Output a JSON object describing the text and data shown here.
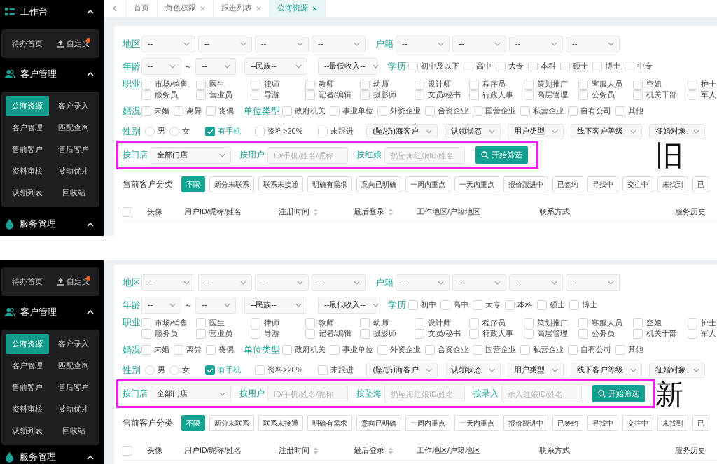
{
  "panels": [
    {
      "annotation": "旧",
      "sidebar": {
        "groups": [
          {
            "title": "工作台",
            "expanded": true,
            "items": [
              {
                "label": "待办首页",
                "kind": "plain",
                "selected": false,
                "dot": false
              },
              {
                "label": "自定义",
                "kind": "icon",
                "selected": false,
                "dot": true
              }
            ]
          },
          {
            "title": "客户管理",
            "expanded": true,
            "items": [
              {
                "label": "公海资源",
                "selected": true
              },
              {
                "label": "客户录入",
                "selected": false
              },
              {
                "label": "客户管理",
                "selected": false
              },
              {
                "label": "匹配查询",
                "selected": false
              },
              {
                "label": "售前客户",
                "selected": false
              },
              {
                "label": "售后客户",
                "selected": false
              },
              {
                "label": "资料审核",
                "selected": false
              },
              {
                "label": "被动优才",
                "selected": false
              },
              {
                "label": "认领列表",
                "selected": false
              },
              {
                "label": "回收站",
                "selected": false
              }
            ]
          },
          {
            "title": "服务管理",
            "expanded": true
          }
        ]
      },
      "tabs": [
        {
          "label": "首页",
          "selected": false,
          "closable": false
        },
        {
          "label": "角色权限",
          "selected": false,
          "closable": true
        },
        {
          "label": "跟进列表",
          "selected": false,
          "closable": true
        },
        {
          "label": "公海资源",
          "selected": true,
          "closable": true
        }
      ],
      "filters": {
        "region": {
          "label": "地区",
          "selects": [
            "--",
            "--",
            "--",
            "--"
          ]
        },
        "hukou": {
          "label": "户籍",
          "selects": [
            "--",
            "--",
            "--",
            "--"
          ]
        },
        "age": {
          "label": "年龄",
          "from": "--",
          "separator": "～",
          "to": "--"
        },
        "ethnicity": "--民族--",
        "income": "--最低收入--",
        "education": {
          "label": "学历",
          "options": [
            {
              "label": "初中及以下",
              "checked": false
            },
            {
              "label": "高中",
              "checked": false
            },
            {
              "label": "大专",
              "checked": false
            },
            {
              "label": "本科",
              "checked": false
            },
            {
              "label": "硕士",
              "checked": false
            },
            {
              "label": "博士",
              "checked": false
            },
            {
              "label": "中专",
              "checked": false
            }
          ]
        },
        "occupation": {
          "label": "职业",
          "options": [
            {
              "label": "市场/销售",
              "checked": false
            },
            {
              "label": "医生",
              "checked": false
            },
            {
              "label": "律师",
              "checked": false
            },
            {
              "label": "教师",
              "checked": false
            },
            {
              "label": "幼师",
              "checked": false
            },
            {
              "label": "设计师",
              "checked": false
            },
            {
              "label": "程序员",
              "checked": false
            },
            {
              "label": "策划推广",
              "checked": false
            },
            {
              "label": "客服人员",
              "checked": false
            },
            {
              "label": "空姐",
              "checked": false
            },
            {
              "label": "护士",
              "checked": false
            },
            {
              "label": "服务员",
              "checked": false
            },
            {
              "label": "营业员",
              "checked": false
            },
            {
              "label": "导游",
              "checked": false
            },
            {
              "label": "记者/编辑",
              "checked": false
            },
            {
              "label": "摄影师",
              "checked": false
            },
            {
              "label": "文员/秘书",
              "checked": false
            },
            {
              "label": "行政人事",
              "checked": false
            },
            {
              "label": "高层管理",
              "checked": false
            },
            {
              "label": "公务员",
              "checked": false
            },
            {
              "label": "机关干部",
              "checked": false
            },
            {
              "label": "军人",
              "checked": false
            }
          ]
        },
        "marriage": {
          "label": "婚况",
          "options": [
            {
              "label": "未婚",
              "checked": false
            },
            {
              "label": "离异",
              "checked": false
            },
            {
              "label": "丧偶",
              "checked": false
            }
          ]
        },
        "unit_type": {
          "label": "单位类型",
          "options": [
            {
              "label": "政府机关",
              "checked": false
            },
            {
              "label": "事业单位",
              "checked": false
            },
            {
              "label": "外资企业",
              "checked": false
            },
            {
              "label": "合资企业",
              "checked": false
            },
            {
              "label": "国营企业",
              "checked": false
            },
            {
              "label": "私营企业",
              "checked": false
            },
            {
              "label": "自有公司",
              "checked": false
            },
            {
              "label": "其他",
              "checked": false
            }
          ]
        },
        "gender": {
          "label": "性别",
          "options": [
            {
              "label": "男",
              "selected": false
            },
            {
              "label": "女",
              "selected": false
            }
          ]
        },
        "flags": [
          {
            "label": "有手机",
            "checked": true
          },
          {
            "label": "资料>20%",
            "checked": false
          },
          {
            "label": "未跟进",
            "checked": false
          }
        ],
        "dropdowns": [
          "(坠/扔)海客户",
          "认领状态",
          "用户类型",
          "线下客户等级",
          "征婚对象"
        ]
      },
      "search": {
        "highlighted": true,
        "fields": [
          {
            "label": "按门店",
            "kind": "select",
            "value": "全部门店"
          },
          {
            "label": "按用户",
            "kind": "input",
            "placeholder": "ID/手机/姓名/昵称"
          },
          {
            "label": "按红娘",
            "kind": "input",
            "placeholder": "扔坠海红娘ID/姓名"
          }
        ],
        "button": "开始筛选"
      },
      "category": {
        "label": "售前客户分类",
        "options": [
          {
            "label": "不限",
            "selected": true
          },
          {
            "label": "新分未联系",
            "selected": false
          },
          {
            "label": "联系未接通",
            "selected": false
          },
          {
            "label": "明确有需求",
            "selected": false
          },
          {
            "label": "意向已明确",
            "selected": false
          },
          {
            "label": "一周内重点",
            "selected": false
          },
          {
            "label": "一天内重点",
            "selected": false
          },
          {
            "label": "报价跟进中",
            "selected": false
          },
          {
            "label": "已签约",
            "selected": false
          },
          {
            "label": "寻找中",
            "selected": false
          },
          {
            "label": "交往中",
            "selected": false
          },
          {
            "label": "未找到",
            "selected": false
          },
          {
            "label": "已",
            "selected": false
          }
        ]
      },
      "table": {
        "all_checked": false,
        "columns": [
          {
            "label": "头像",
            "sortable": false
          },
          {
            "label": "用户ID/昵称/姓名",
            "sortable": false
          },
          {
            "label": "注册时间",
            "sortable": true
          },
          {
            "label": "最后登录",
            "sortable": true
          },
          {
            "label": "工作地区/户籍地区",
            "sortable": false
          },
          {
            "label": "联系方式",
            "sortable": false
          },
          {
            "label": "服务历史",
            "sortable": false
          }
        ]
      }
    },
    {
      "annotation": "新",
      "sidebar": {
        "groups": [
          {
            "items": [
              {
                "label": "待办首页",
                "kind": "plain",
                "selected": false,
                "dot": false
              },
              {
                "label": "自定义",
                "kind": "icon",
                "selected": false,
                "dot": true
              }
            ]
          },
          {
            "title": "客户管理",
            "expanded": true,
            "items": [
              {
                "label": "公海资源",
                "selected": true
              },
              {
                "label": "客户录入",
                "selected": false
              },
              {
                "label": "客户管理",
                "selected": false
              },
              {
                "label": "匹配查询",
                "selected": false
              },
              {
                "label": "售前客户",
                "selected": false
              },
              {
                "label": "售后客户",
                "selected": false
              },
              {
                "label": "资料审核",
                "selected": false
              },
              {
                "label": "被动优才",
                "selected": false
              },
              {
                "label": "认领列表",
                "selected": false
              },
              {
                "label": "回收站",
                "selected": false
              }
            ]
          },
          {
            "title": "服务管理",
            "expanded": true
          }
        ]
      },
      "filters": {
        "region": {
          "label": "地区",
          "selects": [
            "--",
            "--",
            "--",
            "--"
          ]
        },
        "hukou": {
          "label": "户籍",
          "selects": [
            "--",
            "--",
            "--",
            "--"
          ]
        },
        "age": {
          "label": "年龄",
          "from": "--",
          "separator": "～",
          "to": "--"
        },
        "ethnicity": "--民族--",
        "income": "--最低收入--",
        "education": {
          "label": "学历",
          "options": [
            {
              "label": "初中",
              "checked": false
            },
            {
              "label": "高中",
              "checked": false
            },
            {
              "label": "大专",
              "checked": false
            },
            {
              "label": "本科",
              "checked": false
            },
            {
              "label": "硕士",
              "checked": false
            },
            {
              "label": "博士",
              "checked": false
            }
          ]
        },
        "occupation": {
          "label": "职业",
          "options": [
            {
              "label": "市场/销售",
              "checked": false
            },
            {
              "label": "医生",
              "checked": false
            },
            {
              "label": "律师",
              "checked": false
            },
            {
              "label": "教师",
              "checked": false
            },
            {
              "label": "幼师",
              "checked": false
            },
            {
              "label": "设计师",
              "checked": false
            },
            {
              "label": "程序员",
              "checked": false
            },
            {
              "label": "策划推广",
              "checked": false
            },
            {
              "label": "客服人员",
              "checked": false
            },
            {
              "label": "空姐",
              "checked": false
            },
            {
              "label": "护士",
              "checked": false
            },
            {
              "label": "服务员",
              "checked": false
            },
            {
              "label": "营业员",
              "checked": false
            },
            {
              "label": "导游",
              "checked": false
            },
            {
              "label": "记者/编辑",
              "checked": false
            },
            {
              "label": "摄影师",
              "checked": false
            },
            {
              "label": "文员/秘书",
              "checked": false
            },
            {
              "label": "行政人事",
              "checked": false
            },
            {
              "label": "高层管理",
              "checked": false
            },
            {
              "label": "公务员",
              "checked": false
            },
            {
              "label": "机关干部",
              "checked": false
            },
            {
              "label": "军人",
              "checked": false
            }
          ]
        },
        "marriage": {
          "label": "婚况",
          "options": [
            {
              "label": "未婚",
              "checked": false
            },
            {
              "label": "离异",
              "checked": false
            },
            {
              "label": "丧偶",
              "checked": false
            }
          ]
        },
        "unit_type": {
          "label": "单位类型",
          "options": [
            {
              "label": "政府机关",
              "checked": false
            },
            {
              "label": "事业单位",
              "checked": false
            },
            {
              "label": "外资企业",
              "checked": false
            },
            {
              "label": "合资企业",
              "checked": false
            },
            {
              "label": "国营企业",
              "checked": false
            },
            {
              "label": "私营企业",
              "checked": false
            },
            {
              "label": "自有公司",
              "checked": false
            },
            {
              "label": "其他",
              "checked": false
            }
          ]
        },
        "gender": {
          "label": "性别",
          "options": [
            {
              "label": "男",
              "selected": false
            },
            {
              "label": "女",
              "selected": false
            }
          ]
        },
        "flags": [
          {
            "label": "有手机",
            "checked": true
          },
          {
            "label": "资料>20%",
            "checked": false
          },
          {
            "label": "未跟进",
            "checked": false
          }
        ],
        "dropdowns": [
          "(坠/扔)海客户",
          "认领状态",
          "用户类型",
          "线下客户等级",
          "征婚对象"
        ]
      },
      "search": {
        "highlighted": true,
        "fields": [
          {
            "label": "按门店",
            "kind": "select",
            "value": "全部门店"
          },
          {
            "label": "按用户",
            "kind": "input",
            "placeholder": "ID/手机/姓名/昵称"
          },
          {
            "label": "按坠海",
            "kind": "input",
            "placeholder": "扔坠海红娘ID/姓名"
          },
          {
            "label": "按录入",
            "kind": "input",
            "placeholder": "录入红娘ID/姓名"
          }
        ],
        "button": "开始筛选"
      },
      "category": {
        "label": "售前客户分类",
        "options": [
          {
            "label": "不限",
            "selected": true
          },
          {
            "label": "新分未联系",
            "selected": false
          },
          {
            "label": "联系未接通",
            "selected": false
          },
          {
            "label": "明确有需求",
            "selected": false
          },
          {
            "label": "意向已明确",
            "selected": false
          },
          {
            "label": "一周内重点",
            "selected": false
          },
          {
            "label": "一天内重点",
            "selected": false
          },
          {
            "label": "报价跟进中",
            "selected": false
          },
          {
            "label": "已签约",
            "selected": false
          },
          {
            "label": "寻找中",
            "selected": false
          },
          {
            "label": "交往中",
            "selected": false
          },
          {
            "label": "未找到",
            "selected": false
          },
          {
            "label": "已",
            "selected": false
          }
        ]
      },
      "table": {
        "all_checked": false,
        "columns": [
          {
            "label": "头像",
            "sortable": false
          },
          {
            "label": "用户ID/昵称/姓名",
            "sortable": false
          },
          {
            "label": "注册时间",
            "sortable": true
          },
          {
            "label": "最后登录",
            "sortable": true
          },
          {
            "label": "工作地区/户籍地区",
            "sortable": false
          },
          {
            "label": "联系方式",
            "sortable": false
          },
          {
            "label": "服务历史",
            "sortable": false
          }
        ]
      }
    }
  ]
}
